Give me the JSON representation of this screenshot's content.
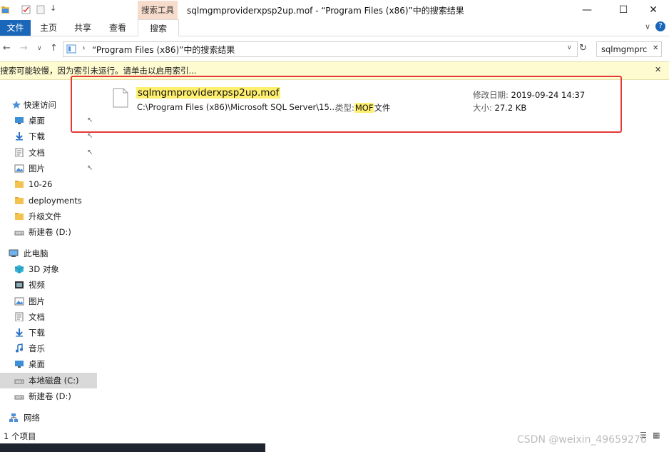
{
  "window": {
    "title": "sqlmgmproviderxpsp2up.mof - “Program Files (x86)”中的搜索结果",
    "context_tab_label": "搜索工具",
    "minimize": "—",
    "maximize": "☐",
    "close": "✕"
  },
  "ribbon": {
    "tabs": [
      "文件",
      "主页",
      "共享",
      "查看",
      "搜索"
    ],
    "collapse_icon": "∨",
    "help_icon": "?"
  },
  "navbar": {
    "back": "←",
    "forward": "→",
    "recent": "∨",
    "up": "↑",
    "address_text": "“Program Files (x86)”中的搜索结果",
    "address_sep": "›",
    "search_value": "sqlmgmprc",
    "refresh": "↻",
    "clear": "✕"
  },
  "infobar": {
    "text": "搜索可能较慢，因为索引未运行。请单击以启用索引...",
    "close": "✕"
  },
  "sidebar": {
    "items": [
      {
        "label": "快速访问",
        "icon": "star-icon",
        "pinned": false
      },
      {
        "label": "桌面",
        "icon": "desktop-icon",
        "pinned": true
      },
      {
        "label": "下载",
        "icon": "download-icon",
        "pinned": true
      },
      {
        "label": "文档",
        "icon": "document-icon",
        "pinned": true
      },
      {
        "label": "图片",
        "icon": "picture-icon",
        "pinned": true
      },
      {
        "label": "10-26",
        "icon": "folder-icon",
        "pinned": false
      },
      {
        "label": "deployments",
        "icon": "folder-icon",
        "pinned": false
      },
      {
        "label": "升级文件",
        "icon": "folder-icon",
        "pinned": false
      },
      {
        "label": "新建卷 (D:)",
        "icon": "drive-icon",
        "pinned": false
      },
      {
        "label": "此电脑",
        "icon": "computer-icon",
        "pinned": false
      },
      {
        "label": "3D 对象",
        "icon": "cube-icon",
        "pinned": false
      },
      {
        "label": "视频",
        "icon": "video-icon",
        "pinned": false
      },
      {
        "label": "图片",
        "icon": "picture-icon",
        "pinned": false
      },
      {
        "label": "文档",
        "icon": "document-icon",
        "pinned": false
      },
      {
        "label": "下载",
        "icon": "download-icon",
        "pinned": false
      },
      {
        "label": "音乐",
        "icon": "music-icon",
        "pinned": false
      },
      {
        "label": "桌面",
        "icon": "desktop-icon",
        "pinned": false
      },
      {
        "label": "本地磁盘 (C:)",
        "icon": "drive-icon",
        "pinned": false
      },
      {
        "label": "新建卷 (D:)",
        "icon": "drive-icon",
        "pinned": false
      },
      {
        "label": "网络",
        "icon": "network-icon",
        "pinned": false
      }
    ],
    "pin_glyph": "📌"
  },
  "result": {
    "file_name": "sqlmgmproviderxpsp2up.mof",
    "path": "C:\\Program Files (x86)\\Microsoft SQL Server\\15...",
    "type_label": "类型:",
    "type_highlight": "MOF",
    "type_suffix": "文件",
    "date_label": "修改日期:",
    "date_value": "2019-09-24 14:37",
    "size_label": "大小:",
    "size_value": "27.2 KB"
  },
  "status": {
    "count": "1 个项目"
  },
  "watermark": "CSDN @weixin_49659276",
  "colors": {
    "accent": "#1a66b8",
    "highlight": "#ffef6e",
    "annotation": "#e53935",
    "context_tab": "#f8dccb"
  }
}
